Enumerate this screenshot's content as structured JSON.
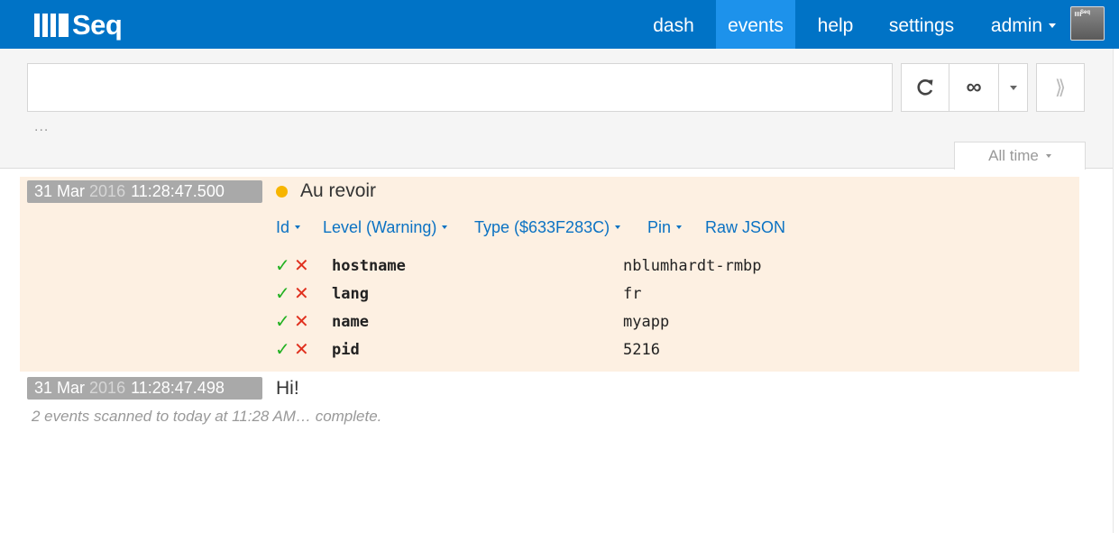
{
  "app": {
    "logo_text": "Seq"
  },
  "nav": {
    "dash": "dash",
    "events": "events",
    "help": "help",
    "settings": "settings",
    "admin": "admin"
  },
  "avatar": {
    "text": "Seq"
  },
  "search": {
    "value": "",
    "placeholder": "",
    "ellipsis": "...",
    "run_icon": "⟫"
  },
  "toolbar": {
    "refresh_icon": "refresh-icon",
    "infinite_icon": "∞"
  },
  "time_range": {
    "label": "All time"
  },
  "events": [
    {
      "date": "31 Mar",
      "year": "2016",
      "time": "11:28:47.500",
      "message": "Au revoir",
      "level_color": "#f7b500",
      "expanded": true,
      "actions": {
        "id": "Id",
        "level": "Level (Warning)",
        "type": "Type ($633F283C)",
        "pin": "Pin",
        "raw": "Raw JSON"
      },
      "properties": [
        {
          "name": "hostname",
          "value": "nblumhardt-rmbp"
        },
        {
          "name": "lang",
          "value": "fr"
        },
        {
          "name": "name",
          "value": "myapp"
        },
        {
          "name": "pid",
          "value": "5216"
        }
      ]
    },
    {
      "date": "31 Mar",
      "year": "2016",
      "time": "11:28:47.498",
      "message": "Hi!",
      "expanded": false
    }
  ],
  "status": {
    "text": "2 events scanned to today at 11:28 AM… complete."
  },
  "colors": {
    "topbar": "#0073c6",
    "active_nav": "#1d92eb",
    "expanded_bg": "#fdf0e2",
    "link": "#0b72c3",
    "include": "#22b122",
    "exclude": "#e0301e"
  }
}
